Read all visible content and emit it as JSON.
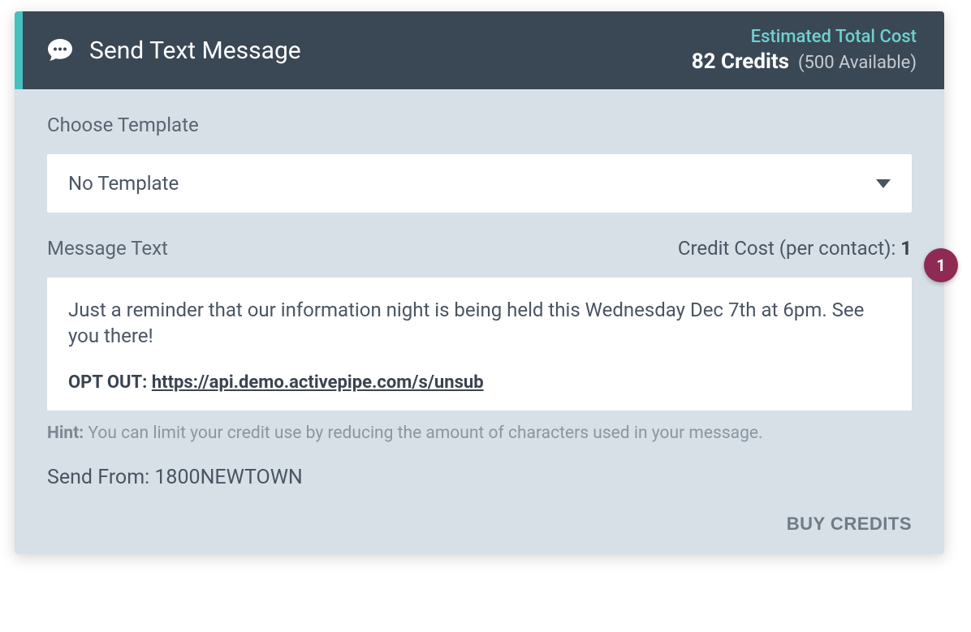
{
  "header": {
    "title": "Send Text Message",
    "cost_label": "Estimated Total Cost",
    "credits_value": "82 Credits",
    "available_text": "(500 Available)",
    "icon": "chat-bubble-icon"
  },
  "template_section": {
    "label": "Choose Template",
    "selected": "No Template"
  },
  "message_section": {
    "label_left": "Message Text",
    "label_right_prefix": "Credit Cost (per contact): ",
    "credit_cost": "1",
    "text": "Just a reminder that our information night is being held this Wednesday Dec 7th at 6pm. See you there!",
    "opt_out_label": "OPT OUT: ",
    "opt_out_link": "https://api.demo.activepipe.com/s/unsub"
  },
  "hint": {
    "label": "Hint:",
    "text": "You can limit your credit use by reducing the amount of characters used in your message."
  },
  "send_from": {
    "label": "Send From: ",
    "value": "1800NEWTOWN"
  },
  "actions": {
    "buy_credits": "BUY CREDITS"
  },
  "annotation": {
    "marker_1": "1"
  },
  "colors": {
    "header_bg": "#3a4754",
    "accent_teal": "#47c0c0",
    "body_bg": "#d6e0e6",
    "badge": "#8e2a53"
  }
}
